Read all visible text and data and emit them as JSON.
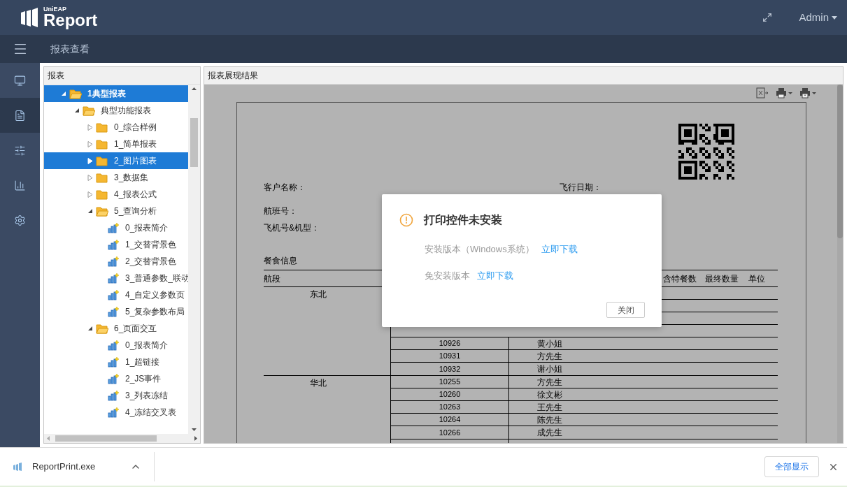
{
  "header": {
    "logo_small": "UniEAP",
    "logo_big": "Report",
    "user": "Admin"
  },
  "breadcrumb": "报表查看",
  "sidebar": {
    "items": [
      {
        "selected": false
      },
      {
        "selected": true
      },
      {
        "selected": false
      },
      {
        "selected": false
      },
      {
        "selected": false
      }
    ]
  },
  "tree": {
    "title": "报表",
    "items": [
      {
        "label": "1典型报表",
        "kind": "folder",
        "expanded": true,
        "selected": true,
        "children": [
          {
            "label": "典型功能报表",
            "kind": "folder",
            "expanded": true,
            "selected": false,
            "children": [
              {
                "label": "0_综合样例",
                "kind": "folder",
                "expanded": false,
                "selected": false
              },
              {
                "label": "1_简单报表",
                "kind": "folder",
                "expanded": false,
                "selected": false
              },
              {
                "label": "2_图片图表",
                "kind": "folder",
                "expanded": false,
                "selected": true
              },
              {
                "label": "3_数据集",
                "kind": "folder",
                "expanded": false,
                "selected": false
              },
              {
                "label": "4_报表公式",
                "kind": "folder",
                "expanded": false,
                "selected": false
              },
              {
                "label": "5_查询分析",
                "kind": "folder",
                "expanded": true,
                "selected": false,
                "children": [
                  {
                    "label": "0_报表简介",
                    "kind": "report",
                    "selected": false
                  },
                  {
                    "label": "1_交替背景色",
                    "kind": "report",
                    "selected": false
                  },
                  {
                    "label": "2_交替背景色",
                    "kind": "report",
                    "selected": false
                  },
                  {
                    "label": "3_普通参数_联动",
                    "kind": "report",
                    "selected": false
                  },
                  {
                    "label": "4_自定义参数页",
                    "kind": "report",
                    "selected": false
                  },
                  {
                    "label": "5_复杂参数布局",
                    "kind": "report",
                    "selected": false
                  }
                ]
              },
              {
                "label": "6_页面交互",
                "kind": "folder",
                "expanded": true,
                "selected": false,
                "children": [
                  {
                    "label": "0_报表简介",
                    "kind": "report",
                    "selected": false
                  },
                  {
                    "label": "1_超链接",
                    "kind": "report",
                    "selected": false
                  },
                  {
                    "label": "2_JS事件",
                    "kind": "report",
                    "selected": false
                  },
                  {
                    "label": "3_列表冻结",
                    "kind": "report",
                    "selected": false
                  },
                  {
                    "label": "4_冻结交叉表",
                    "kind": "report",
                    "selected": false
                  }
                ]
              }
            ]
          }
        ]
      }
    ]
  },
  "report": {
    "title": "报表展现结果",
    "fields": {
      "customer": "客户名称：",
      "date": "飞行日期：",
      "flight": "航班号：",
      "plane": "飞机号&机型："
    },
    "section": "餐食信息",
    "columns": [
      "航段",
      "含特餐数",
      "最终数量",
      "单位"
    ],
    "groups": [
      {
        "region": "东北",
        "rows": [
          {
            "flight": "10926",
            "name": "黄小姐"
          },
          {
            "flight": "10931",
            "name": "方先生"
          },
          {
            "flight": "10932",
            "name": "谢小姐"
          }
        ]
      },
      {
        "region": "华北",
        "rows": [
          {
            "flight": "10255",
            "name": "方先生"
          },
          {
            "flight": "10260",
            "name": "徐文彬"
          },
          {
            "flight": "10263",
            "name": "王先生"
          },
          {
            "flight": "10264",
            "name": "陈先生"
          },
          {
            "flight": "10266",
            "name": "成先生"
          }
        ]
      }
    ]
  },
  "dialog": {
    "title": "打印控件未安装",
    "lines": [
      {
        "text": "安装版本（Windows系统）",
        "link": "立即下载"
      },
      {
        "text": "免安装版本",
        "link": "立即下载"
      }
    ],
    "close": "关闭"
  },
  "download_bar": {
    "file": "ReportPrint.exe",
    "show_all": "全部显示"
  }
}
